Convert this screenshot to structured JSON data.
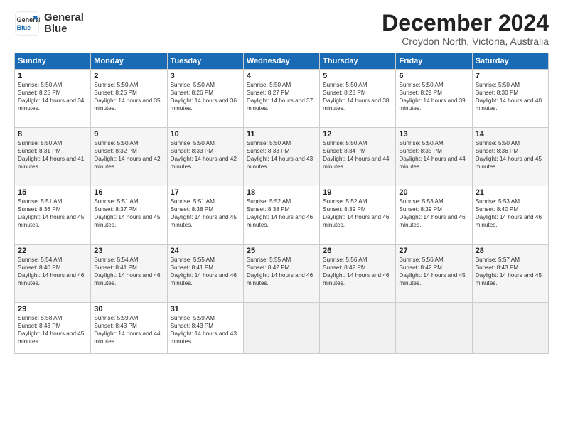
{
  "app": {
    "logo_line1": "General",
    "logo_line2": "Blue",
    "title": "December 2024",
    "subtitle": "Croydon North, Victoria, Australia"
  },
  "calendar": {
    "headers": [
      "Sunday",
      "Monday",
      "Tuesday",
      "Wednesday",
      "Thursday",
      "Friday",
      "Saturday"
    ],
    "weeks": [
      [
        {
          "day": "1",
          "sunrise": "Sunrise: 5:50 AM",
          "sunset": "Sunset: 8:25 PM",
          "daylight": "Daylight: 14 hours and 34 minutes."
        },
        {
          "day": "2",
          "sunrise": "Sunrise: 5:50 AM",
          "sunset": "Sunset: 8:25 PM",
          "daylight": "Daylight: 14 hours and 35 minutes."
        },
        {
          "day": "3",
          "sunrise": "Sunrise: 5:50 AM",
          "sunset": "Sunset: 8:26 PM",
          "daylight": "Daylight: 14 hours and 36 minutes."
        },
        {
          "day": "4",
          "sunrise": "Sunrise: 5:50 AM",
          "sunset": "Sunset: 8:27 PM",
          "daylight": "Daylight: 14 hours and 37 minutes."
        },
        {
          "day": "5",
          "sunrise": "Sunrise: 5:50 AM",
          "sunset": "Sunset: 8:28 PM",
          "daylight": "Daylight: 14 hours and 38 minutes."
        },
        {
          "day": "6",
          "sunrise": "Sunrise: 5:50 AM",
          "sunset": "Sunset: 8:29 PM",
          "daylight": "Daylight: 14 hours and 39 minutes."
        },
        {
          "day": "7",
          "sunrise": "Sunrise: 5:50 AM",
          "sunset": "Sunset: 8:30 PM",
          "daylight": "Daylight: 14 hours and 40 minutes."
        }
      ],
      [
        {
          "day": "8",
          "sunrise": "Sunrise: 5:50 AM",
          "sunset": "Sunset: 8:31 PM",
          "daylight": "Daylight: 14 hours and 41 minutes."
        },
        {
          "day": "9",
          "sunrise": "Sunrise: 5:50 AM",
          "sunset": "Sunset: 8:32 PM",
          "daylight": "Daylight: 14 hours and 42 minutes."
        },
        {
          "day": "10",
          "sunrise": "Sunrise: 5:50 AM",
          "sunset": "Sunset: 8:33 PM",
          "daylight": "Daylight: 14 hours and 42 minutes."
        },
        {
          "day": "11",
          "sunrise": "Sunrise: 5:50 AM",
          "sunset": "Sunset: 8:33 PM",
          "daylight": "Daylight: 14 hours and 43 minutes."
        },
        {
          "day": "12",
          "sunrise": "Sunrise: 5:50 AM",
          "sunset": "Sunset: 8:34 PM",
          "daylight": "Daylight: 14 hours and 44 minutes."
        },
        {
          "day": "13",
          "sunrise": "Sunrise: 5:50 AM",
          "sunset": "Sunset: 8:35 PM",
          "daylight": "Daylight: 14 hours and 44 minutes."
        },
        {
          "day": "14",
          "sunrise": "Sunrise: 5:50 AM",
          "sunset": "Sunset: 8:36 PM",
          "daylight": "Daylight: 14 hours and 45 minutes."
        }
      ],
      [
        {
          "day": "15",
          "sunrise": "Sunrise: 5:51 AM",
          "sunset": "Sunset: 8:36 PM",
          "daylight": "Daylight: 14 hours and 45 minutes."
        },
        {
          "day": "16",
          "sunrise": "Sunrise: 5:51 AM",
          "sunset": "Sunset: 8:37 PM",
          "daylight": "Daylight: 14 hours and 45 minutes."
        },
        {
          "day": "17",
          "sunrise": "Sunrise: 5:51 AM",
          "sunset": "Sunset: 8:38 PM",
          "daylight": "Daylight: 14 hours and 45 minutes."
        },
        {
          "day": "18",
          "sunrise": "Sunrise: 5:52 AM",
          "sunset": "Sunset: 8:38 PM",
          "daylight": "Daylight: 14 hours and 46 minutes."
        },
        {
          "day": "19",
          "sunrise": "Sunrise: 5:52 AM",
          "sunset": "Sunset: 8:39 PM",
          "daylight": "Daylight: 14 hours and 46 minutes."
        },
        {
          "day": "20",
          "sunrise": "Sunrise: 5:53 AM",
          "sunset": "Sunset: 8:39 PM",
          "daylight": "Daylight: 14 hours and 46 minutes."
        },
        {
          "day": "21",
          "sunrise": "Sunrise: 5:53 AM",
          "sunset": "Sunset: 8:40 PM",
          "daylight": "Daylight: 14 hours and 46 minutes."
        }
      ],
      [
        {
          "day": "22",
          "sunrise": "Sunrise: 5:54 AM",
          "sunset": "Sunset: 8:40 PM",
          "daylight": "Daylight: 14 hours and 46 minutes."
        },
        {
          "day": "23",
          "sunrise": "Sunrise: 5:54 AM",
          "sunset": "Sunset: 8:41 PM",
          "daylight": "Daylight: 14 hours and 46 minutes."
        },
        {
          "day": "24",
          "sunrise": "Sunrise: 5:55 AM",
          "sunset": "Sunset: 8:41 PM",
          "daylight": "Daylight: 14 hours and 46 minutes."
        },
        {
          "day": "25",
          "sunrise": "Sunrise: 5:55 AM",
          "sunset": "Sunset: 8:42 PM",
          "daylight": "Daylight: 14 hours and 46 minutes."
        },
        {
          "day": "26",
          "sunrise": "Sunrise: 5:56 AM",
          "sunset": "Sunset: 8:42 PM",
          "daylight": "Daylight: 14 hours and 46 minutes."
        },
        {
          "day": "27",
          "sunrise": "Sunrise: 5:56 AM",
          "sunset": "Sunset: 8:42 PM",
          "daylight": "Daylight: 14 hours and 45 minutes."
        },
        {
          "day": "28",
          "sunrise": "Sunrise: 5:57 AM",
          "sunset": "Sunset: 8:43 PM",
          "daylight": "Daylight: 14 hours and 45 minutes."
        }
      ],
      [
        {
          "day": "29",
          "sunrise": "Sunrise: 5:58 AM",
          "sunset": "Sunset: 8:43 PM",
          "daylight": "Daylight: 14 hours and 45 minutes."
        },
        {
          "day": "30",
          "sunrise": "Sunrise: 5:59 AM",
          "sunset": "Sunset: 8:43 PM",
          "daylight": "Daylight: 14 hours and 44 minutes."
        },
        {
          "day": "31",
          "sunrise": "Sunrise: 5:59 AM",
          "sunset": "Sunset: 8:43 PM",
          "daylight": "Daylight: 14 hours and 43 minutes."
        },
        null,
        null,
        null,
        null
      ]
    ]
  }
}
